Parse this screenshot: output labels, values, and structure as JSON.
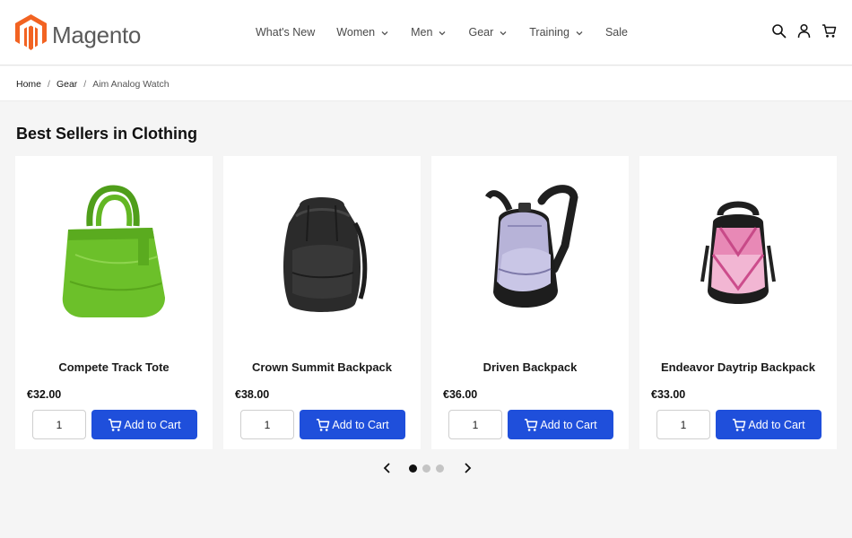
{
  "header": {
    "logo_text": "Magento",
    "brand_color": "#f26322",
    "nav": [
      {
        "label": "What's New",
        "has_dropdown": false
      },
      {
        "label": "Women",
        "has_dropdown": true
      },
      {
        "label": "Men",
        "has_dropdown": true
      },
      {
        "label": "Gear",
        "has_dropdown": true
      },
      {
        "label": "Training",
        "has_dropdown": true
      },
      {
        "label": "Sale",
        "has_dropdown": false
      }
    ],
    "icons": [
      "search-icon",
      "account-icon",
      "cart-icon"
    ]
  },
  "breadcrumb": {
    "items": [
      {
        "label": "Home"
      },
      {
        "label": "Gear"
      }
    ],
    "separator": "/",
    "current": "Aim Analog Watch"
  },
  "section": {
    "title": "Best Sellers in Clothing"
  },
  "products": [
    {
      "name": "Compete Track Tote",
      "price": "€32.00",
      "qty": "1",
      "button": "Add to Cart",
      "image": "green-tote-bag"
    },
    {
      "name": "Crown Summit Backpack",
      "price": "€38.00",
      "qty": "1",
      "button": "Add to Cart",
      "image": "black-backpack"
    },
    {
      "name": "Driven Backpack",
      "price": "€36.00",
      "qty": "1",
      "button": "Add to Cart",
      "image": "lavender-backpack"
    },
    {
      "name": "Endeavor Daytrip Backpack",
      "price": "€33.00",
      "qty": "1",
      "button": "Add to Cart",
      "image": "pink-black-backpack"
    }
  ],
  "pager": {
    "pages": 3,
    "active_page": 1
  },
  "colors": {
    "button_bg": "#1f4fdb",
    "page_bg": "#f5f5f5"
  }
}
